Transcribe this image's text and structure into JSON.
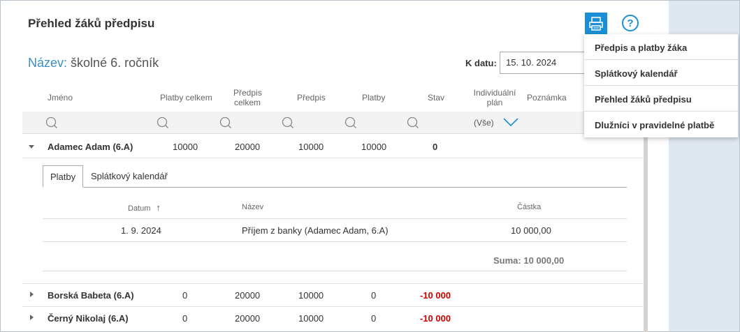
{
  "page": {
    "title": "Přehled žáků předpisu",
    "name_label": "Název:",
    "name_value": "školné 6. ročník",
    "date_label": "K datu:",
    "date_value": "15. 10. 2024",
    "help": "?"
  },
  "menu": [
    {
      "label": "Předpis a platby žáka"
    },
    {
      "label": "Splátkový kalendář"
    },
    {
      "label": "Přehled žáků předpisu"
    },
    {
      "label": "Dlužníci v pravidelné platbě"
    }
  ],
  "columns": {
    "name": "Jméno",
    "total_payments": "Platby celkem",
    "prescription_total_1": "Předpis",
    "prescription_total_2": "celkem",
    "prescription": "Předpis",
    "payments": "Platby",
    "status": "Stav",
    "individual_1": "Individuální",
    "individual_2": "plán",
    "note": "Poznámka"
  },
  "filter": {
    "individual_value": "(Vše)"
  },
  "rows": [
    {
      "name": "Adamec Adam (6.A)",
      "total": "10000",
      "presc_total": "20000",
      "presc": "10000",
      "payments": "10000",
      "status": "0"
    },
    {
      "name": "Borská Babeta (6.A)",
      "total": "0",
      "presc_total": "20000",
      "presc": "10000",
      "payments": "0",
      "status": "-10 000"
    },
    {
      "name": "Černý Nikolaj (6.A)",
      "total": "0",
      "presc_total": "20000",
      "presc": "10000",
      "payments": "0",
      "status": "-10 000"
    }
  ],
  "detail": {
    "tabs": [
      "Platby",
      "Splátkový kalendář"
    ],
    "headers": {
      "date": "Datum",
      "sort_arrow": "↑",
      "name": "Název",
      "amount": "Částka"
    },
    "items": [
      {
        "date": "1. 9. 2024",
        "name": "Příjem z banky (Adamec Adam, 6.A)",
        "amount": "10 000,00"
      }
    ],
    "sum": "Suma: 10 000,00"
  },
  "colors": {
    "accent": "#1a8fd6",
    "negative": "#cc0000",
    "panel": "#dfe7f1"
  }
}
